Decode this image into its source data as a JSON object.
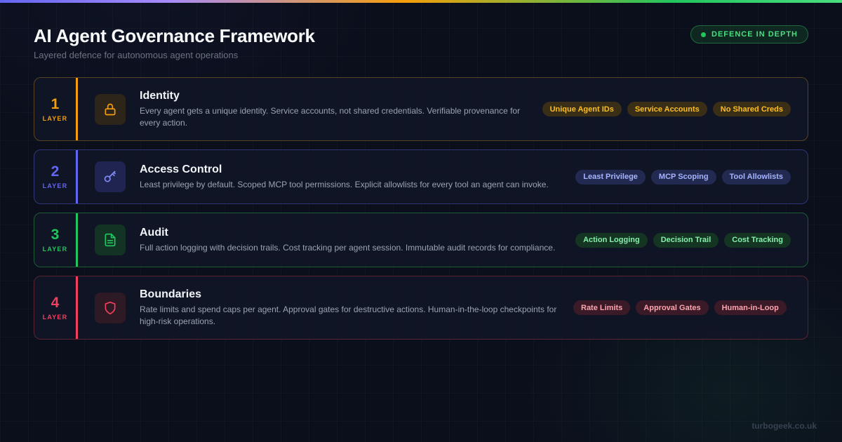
{
  "header": {
    "title": "AI Agent Governance Framework",
    "subtitle": "Layered defence for autonomous agent operations",
    "badge": "DEFENCE IN DEPTH"
  },
  "colors": {
    "identity": "#f59e0b",
    "access_control": "#6366f1",
    "audit": "#22c55e",
    "boundaries": "#f43f5e"
  },
  "layers": [
    {
      "number": "1",
      "label": "LAYER",
      "icon": "lock-icon",
      "title": "Identity",
      "description": "Every agent gets a unique identity. Service accounts, not shared credentials. Verifiable provenance for every action.",
      "tags": [
        "Unique Agent IDs",
        "Service Accounts",
        "No Shared Creds"
      ]
    },
    {
      "number": "2",
      "label": "LAYER",
      "icon": "key-icon",
      "title": "Access Control",
      "description": "Least privilege by default. Scoped MCP tool permissions. Explicit allowlists for every tool an agent can invoke.",
      "tags": [
        "Least Privilege",
        "MCP Scoping",
        "Tool Allowlists"
      ]
    },
    {
      "number": "3",
      "label": "LAYER",
      "icon": "document-icon",
      "title": "Audit",
      "description": "Full action logging with decision trails. Cost tracking per agent session. Immutable audit records for compliance.",
      "tags": [
        "Action Logging",
        "Decision Trail",
        "Cost Tracking"
      ]
    },
    {
      "number": "4",
      "label": "LAYER",
      "icon": "shield-icon",
      "title": "Boundaries",
      "description": "Rate limits and spend caps per agent. Approval gates for destructive actions. Human-in-the-loop checkpoints for high-risk operations.",
      "tags": [
        "Rate Limits",
        "Approval Gates",
        "Human-in-Loop"
      ]
    }
  ],
  "footer": "turbogeek.co.uk"
}
